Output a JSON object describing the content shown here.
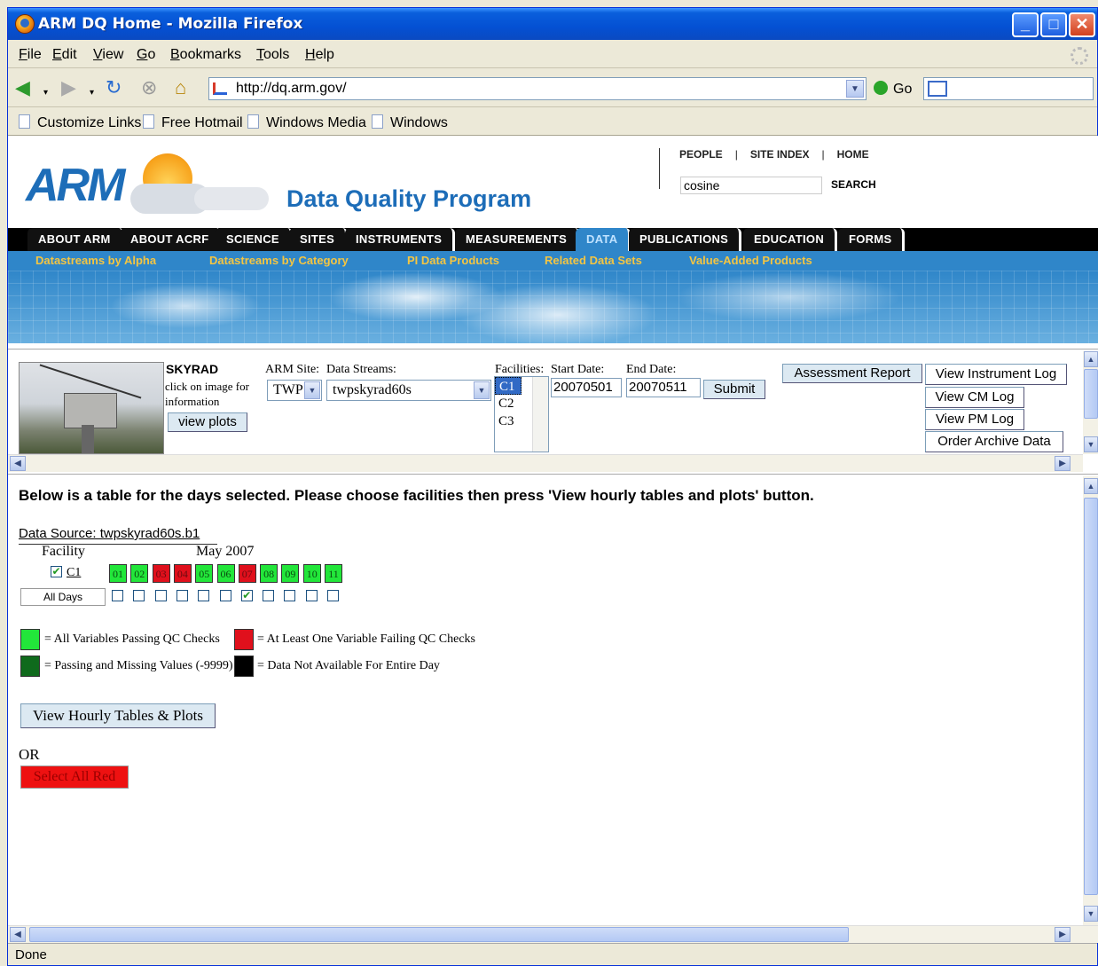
{
  "window": {
    "title": "ARM DQ Home - Mozilla Firefox"
  },
  "menu": [
    "File",
    "Edit",
    "View",
    "Go",
    "Bookmarks",
    "Tools",
    "Help"
  ],
  "nav": {
    "url": "http://dq.arm.gov/",
    "go_label": "Go"
  },
  "links_bar": [
    "Customize Links",
    "Free Hotmail",
    "Windows Media",
    "Windows"
  ],
  "site": {
    "logo": "ARM",
    "program_title": "Data Quality Program",
    "top_links": [
      "PEOPLE",
      "SITE INDEX",
      "HOME"
    ],
    "search_value": "cosine",
    "search_label": "SEARCH",
    "tabs": [
      "ABOUT ARM",
      "ABOUT ACRF",
      "SCIENCE",
      "SITES",
      "INSTRUMENTS",
      "MEASUREMENTS",
      "DATA",
      "PUBLICATIONS",
      "EDUCATION",
      "FORMS"
    ],
    "active_tab": "DATA",
    "subnav": [
      "Datastreams by Alpha",
      "Datastreams by Category",
      "PI Data Products",
      "Related Data Sets",
      "Value-Added Products"
    ]
  },
  "controls": {
    "instrument_name": "SKYRAD",
    "image_hint": "click on image for information",
    "view_plots": "view plots",
    "arm_site_label": "ARM Site:",
    "arm_site_value": "TWP",
    "datastreams_label": "Data Streams:",
    "datastream_value": "twpskyrad60s",
    "facilities_label": "Facilities:",
    "facilities": [
      "C1",
      "C2",
      "C3"
    ],
    "selected_facility": "C1",
    "start_label": "Start Date:",
    "start_value": "20070501",
    "end_label": "End Date:",
    "end_value": "20070511",
    "submit": "Submit",
    "assessment_report": "Assessment Report",
    "view_instrument_log": "View Instrument Log",
    "view_cm_log": "View CM Log",
    "view_pm_log": "View PM Log",
    "order_archive": "Order Archive Data"
  },
  "main": {
    "headline": "Below is a table for the days selected.  Please choose facilities then press 'View hourly tables and plots' button.",
    "data_source": "Data Source: twpskyrad60s.b1",
    "facility_header": "Facility",
    "month_header": "May 2007",
    "facility_row": "C1",
    "all_days": "All Days",
    "days": [
      {
        "d": "01",
        "status": "pass"
      },
      {
        "d": "02",
        "status": "pass"
      },
      {
        "d": "03",
        "status": "fail"
      },
      {
        "d": "04",
        "status": "fail"
      },
      {
        "d": "05",
        "status": "pass"
      },
      {
        "d": "06",
        "status": "pass"
      },
      {
        "d": "07",
        "status": "fail"
      },
      {
        "d": "08",
        "status": "pass"
      },
      {
        "d": "09",
        "status": "pass"
      },
      {
        "d": "10",
        "status": "pass"
      },
      {
        "d": "11",
        "status": "pass"
      }
    ],
    "day_checked": [
      false,
      false,
      false,
      false,
      false,
      false,
      true,
      false,
      false,
      false,
      false
    ],
    "legend": [
      {
        "color": "#22e63a",
        "text": "= All Variables Passing QC Checks"
      },
      {
        "color": "#e0101c",
        "text": "= At Least One Variable Failing QC Checks"
      },
      {
        "color": "#0f6a1c",
        "text": "= Passing and Missing Values (-9999)"
      },
      {
        "color": "#000000",
        "text": "= Data Not Available For Entire Day"
      }
    ],
    "view_hourly": "View Hourly Tables & Plots",
    "or_text": "OR",
    "select_all_red": "Select All Red"
  },
  "status": "Done"
}
